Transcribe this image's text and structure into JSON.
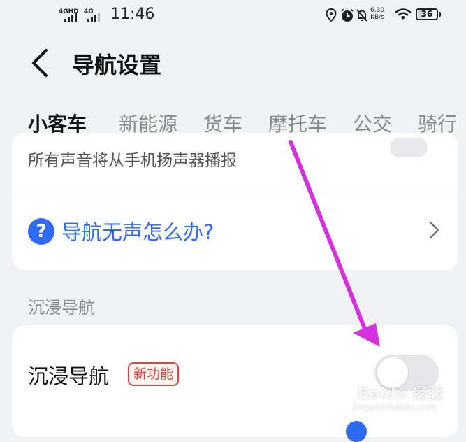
{
  "status_bar": {
    "sim1": "4GHD",
    "sim2": "4G",
    "time": "11:46",
    "net_speed_value": "6.30",
    "net_speed_unit": "KB/s",
    "battery": "36",
    "battery_level": 0.36
  },
  "header": {
    "title": "导航设置",
    "back_icon": "chevron-left-icon"
  },
  "tabs": [
    {
      "label": "小客车",
      "active": true
    },
    {
      "label": "新能源",
      "active": false
    },
    {
      "label": "货车",
      "active": false
    },
    {
      "label": "摩托车",
      "active": false
    },
    {
      "label": "公交",
      "active": false
    },
    {
      "label": "骑行",
      "active": false
    }
  ],
  "sound_card": {
    "subtext": "所有声音将从手机扬声器播报",
    "help_link": "导航无声怎么办?",
    "help_icon": "?"
  },
  "immersive_section": {
    "section_label": "沉浸导航",
    "row_label": "沉浸导航",
    "badge": "新功能",
    "toggle_on": false
  },
  "watermark": {
    "text": "Baidu 经验",
    "url": "jingyan.baidu.com"
  },
  "colors": {
    "accent": "#2f6bf2",
    "badge_red": "#e8403d",
    "arrow_magenta": "#d62fe0"
  }
}
